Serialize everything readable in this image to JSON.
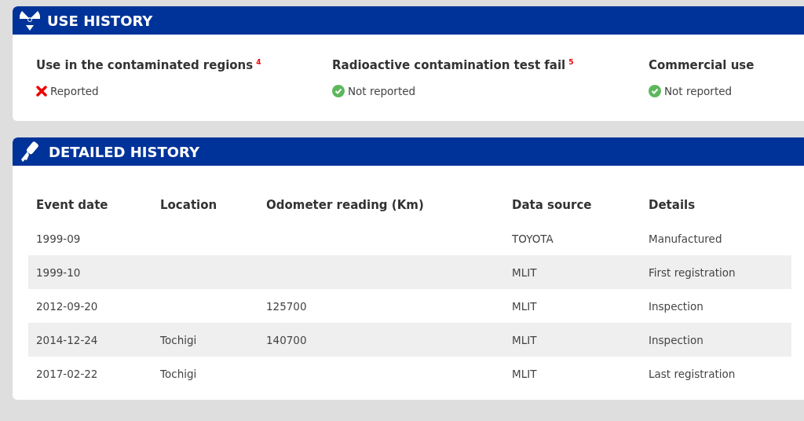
{
  "use_history": {
    "title": "USE HISTORY",
    "items": [
      {
        "label": "Use in the contaminated regions",
        "note": "4",
        "reported": true,
        "status": "Reported"
      },
      {
        "label": "Radioactive contamination test fail",
        "note": "5",
        "reported": false,
        "status": "Not reported"
      },
      {
        "label": "Commercial use",
        "reported": false,
        "status": "Not reported"
      }
    ]
  },
  "detailed_history": {
    "title": "DETAILED HISTORY",
    "columns": [
      "Event date",
      "Location",
      "Odometer reading (Km)",
      "Data source",
      "Details"
    ],
    "rows": [
      [
        "1999-09",
        "",
        "",
        "TOYOTA",
        "Manufactured"
      ],
      [
        "1999-10",
        "",
        "",
        "MLIT",
        "First registration"
      ],
      [
        "2012-09-20",
        "",
        "125700",
        "MLIT",
        "Inspection"
      ],
      [
        "2014-12-24",
        "Tochigi",
        "140700",
        "MLIT",
        "Inspection"
      ],
      [
        "2017-02-22",
        "Tochigi",
        "",
        "MLIT",
        "Last registration"
      ]
    ]
  }
}
